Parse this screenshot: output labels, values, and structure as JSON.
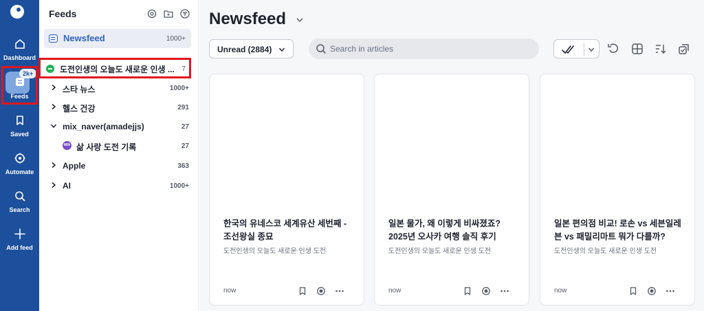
{
  "rail": {
    "items": [
      {
        "label": "Dashboard",
        "icon": "home-icon"
      },
      {
        "label": "Feeds",
        "icon": "feeds-icon",
        "badge": "2k+"
      },
      {
        "label": "Saved",
        "icon": "bookmark-icon"
      },
      {
        "label": "Automate",
        "icon": "automate-icon"
      },
      {
        "label": "Search",
        "icon": "search-icon"
      },
      {
        "label": "Add feed",
        "icon": "plus-icon"
      }
    ]
  },
  "panel": {
    "title": "Feeds",
    "icons": [
      "gear-icon",
      "add-folder-icon",
      "filter-icon"
    ],
    "newsfeed": {
      "label": "Newsfeed",
      "count": "1000+"
    },
    "selected": {
      "name": "도전인생의 오늘도 새로운 인생 ...",
      "count": "7"
    },
    "feeds": [
      {
        "name": "스타 뉴스",
        "count": "1000+",
        "expanded": false
      },
      {
        "name": "헬스 건강",
        "count": "291",
        "expanded": false
      },
      {
        "name": "mix_naver(amadejjs)",
        "count": "27",
        "expanded": true
      },
      {
        "name": "삶 사랑 도전 기록",
        "count": "27",
        "sub": true,
        "icon_text": "MIN"
      },
      {
        "name": "Apple",
        "count": "363",
        "expanded": false
      },
      {
        "name": "AI",
        "count": "1000+",
        "expanded": false
      }
    ]
  },
  "main": {
    "title": "Newsfeed",
    "filter": "Unread (2884)",
    "search_placeholder": "Search in articles",
    "cards": [
      {
        "title": "한국의 유네스코 세계유산 세번째 - 조선왕실 종묘",
        "source": "도전인생의 오늘도 새로운 인생 도전",
        "time": "now"
      },
      {
        "title": "일본 물가, 왜 이렇게 비싸졌죠? 2025년 오사카 여행 솔직 후기",
        "source": "도전인생의 오늘도 새로운 인생 도전",
        "time": "now"
      },
      {
        "title": "일본 편의점 비교! 로손 vs 세븐일레븐 vs 패밀리마트 뭐가 다를까?",
        "source": "도전인생의 오늘도 새로운 인생 도전",
        "time": "now"
      }
    ]
  },
  "colors": {
    "rail": "#1c4f9c",
    "accent": "#2f63c0",
    "highlight": "#e0161b"
  }
}
